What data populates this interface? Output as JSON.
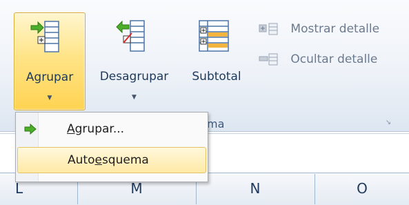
{
  "ribbon": {
    "group_label": "ma",
    "launcher_icon": "dialog-launcher-icon",
    "buttons": {
      "agrupar": {
        "label": "Agrupar",
        "icon": "group-icon",
        "state": "pressed"
      },
      "desagrupar": {
        "label": "Desagrupar",
        "icon": "ungroup-icon"
      },
      "subtotal": {
        "label": "Subtotal",
        "icon": "subtotal-icon"
      }
    },
    "small_buttons": {
      "mostrar": {
        "label": "Mostrar detalle",
        "icon": "show-detail-icon",
        "enabled": false
      },
      "ocultar": {
        "label": "Ocultar detalle",
        "icon": "hide-detail-icon",
        "enabled": false
      }
    }
  },
  "menu": {
    "items": [
      {
        "label_pre": "",
        "label_key": "A",
        "label_post": "grupar...",
        "icon": "green-arrow-icon"
      },
      {
        "label_pre": "Auto",
        "label_key": "e",
        "label_post": "squema",
        "icon": "",
        "highlighted": true
      }
    ]
  },
  "columns": [
    "L",
    "M",
    "N",
    "O"
  ],
  "colors": {
    "accent": "#ffd352",
    "ribbon_bg": "#eef2f8",
    "text": "#1e395b"
  }
}
